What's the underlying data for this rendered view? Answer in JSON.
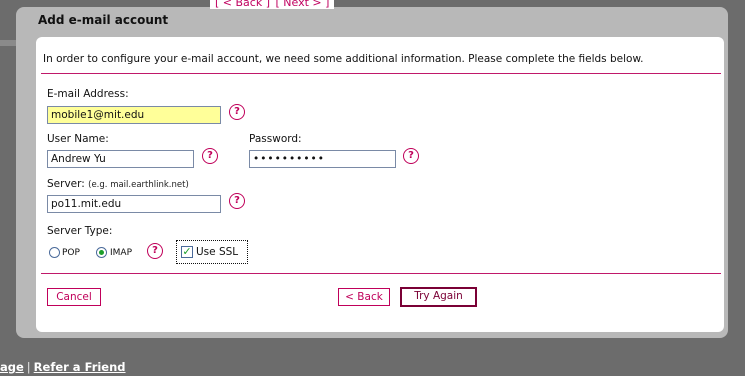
{
  "top_nav": {
    "back": "[ < Back ]",
    "next": "[ Next > ]"
  },
  "dialog": {
    "title": "Add e-mail account",
    "intro": "In order to configure your e-mail account, we need some additional information. Please complete the fields below."
  },
  "form": {
    "email": {
      "label": "E-mail Address:",
      "value": "mobile1@mit.edu"
    },
    "username": {
      "label": "User Name:",
      "value": "Andrew Yu"
    },
    "password": {
      "label": "Password:",
      "value": "••••••••••"
    },
    "server": {
      "label": "Server:",
      "hint": "(e.g. mail.earthlink.net)",
      "value": "po11.mit.edu"
    },
    "server_type": {
      "label": "Server Type:",
      "pop_label": "POP",
      "imap_label": "IMAP",
      "selected": "IMAP"
    },
    "ssl": {
      "label": "Use SSL",
      "checked": true
    },
    "help_glyph": "?"
  },
  "buttons": {
    "cancel": "Cancel",
    "back": "< Back",
    "try_again": "Try Again"
  },
  "footer": {
    "page_link": "age",
    "separator": "|",
    "refer_link": "Refer a Friend"
  },
  "colors": {
    "accent": "#c0005a",
    "highlight_field": "#ffff99",
    "frame": "#b8b8b8",
    "backdrop": "#6c6c6c"
  }
}
